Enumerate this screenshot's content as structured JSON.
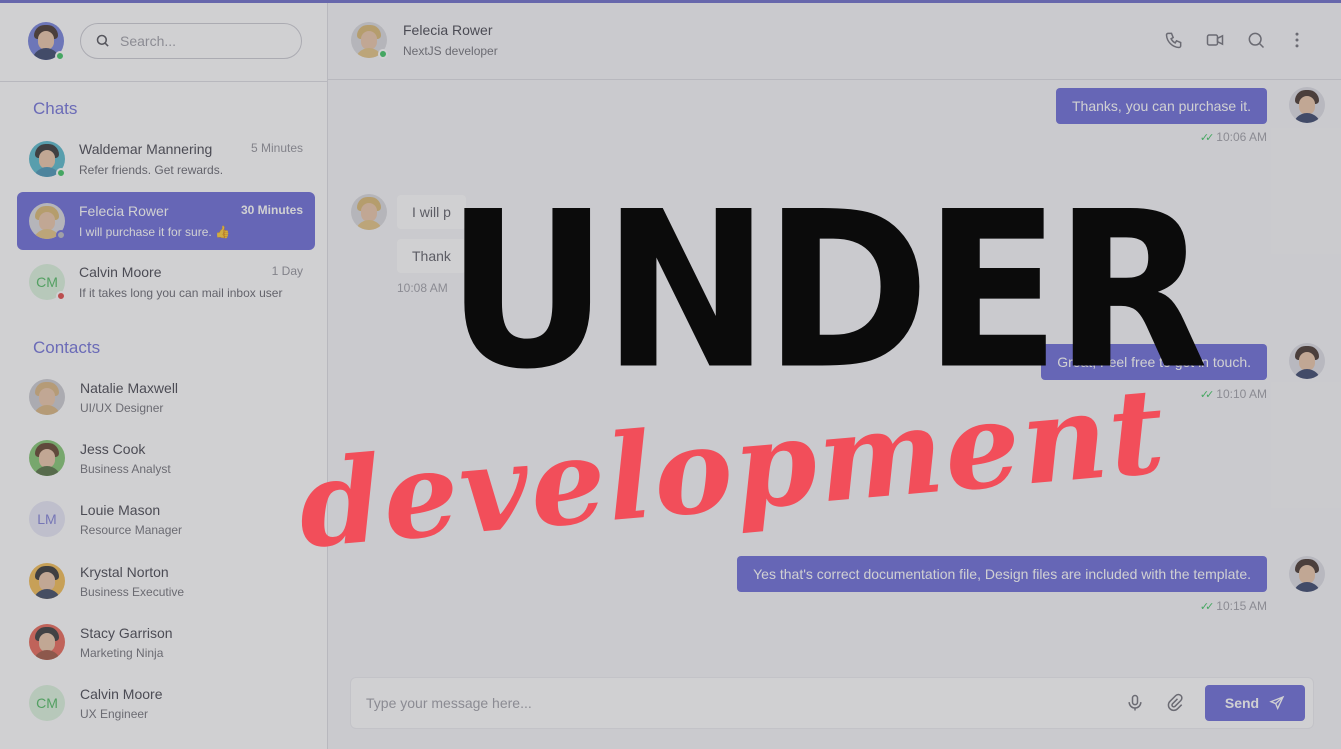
{
  "search": {
    "placeholder": "Search..."
  },
  "sections": {
    "chats": "Chats",
    "contacts": "Contacts"
  },
  "chats": [
    {
      "name": "Waldemar Mannering",
      "time": "5 Minutes",
      "message": "Refer friends. Get rewards.",
      "status": "online"
    },
    {
      "name": "Felecia Rower",
      "time": "30 Minutes",
      "message": "I will purchase it for sure. 👍",
      "status": "offline",
      "active": true
    },
    {
      "name": "Calvin Moore",
      "initials": "CM",
      "time": "1 Day",
      "message": "If it takes long you can mail inbox user",
      "status": "busy"
    }
  ],
  "contacts": [
    {
      "name": "Natalie Maxwell",
      "role": "UI/UX Designer"
    },
    {
      "name": "Jess Cook",
      "role": "Business Analyst"
    },
    {
      "name": "Louie Mason",
      "initials": "LM",
      "role": "Resource Manager"
    },
    {
      "name": "Krystal Norton",
      "role": "Business Executive"
    },
    {
      "name": "Stacy Garrison",
      "role": "Marketing Ninja"
    },
    {
      "name": "Calvin Moore",
      "initials": "CM",
      "role": "UX Engineer"
    }
  ],
  "header": {
    "name": "Felecia Rower",
    "role": "NextJS developer"
  },
  "header_icons": [
    "phone-icon",
    "video-icon",
    "search-icon",
    "more-vertical-icon"
  ],
  "messages": [
    {
      "direction": "out",
      "text": "Thanks, you can purchase it.",
      "time": "10:06 AM"
    },
    {
      "direction": "in",
      "text": "I will purchase it for sure. 👍",
      "visible_text": "I will p",
      "time": ""
    },
    {
      "direction": "in",
      "text": "Thanks",
      "visible_text": "Thank",
      "time": "10:08 AM"
    },
    {
      "direction": "out",
      "text": "Great, Feel free to get in touch.",
      "time": "10:10 AM"
    },
    {
      "direction": "in",
      "text": "",
      "time": ""
    },
    {
      "direction": "out",
      "text": "Yes that's correct documentation file, Design files are included with the template.",
      "time": "10:15 AM"
    }
  ],
  "composer": {
    "placeholder": "Type your message here...",
    "send_label": "Send"
  },
  "overlay": {
    "title": "UNDER",
    "subtitle": "development"
  },
  "colors": {
    "accent": "#6363d6",
    "online": "#33c25a",
    "busy": "#e0403f",
    "overlay_red": "#f24e5a"
  }
}
